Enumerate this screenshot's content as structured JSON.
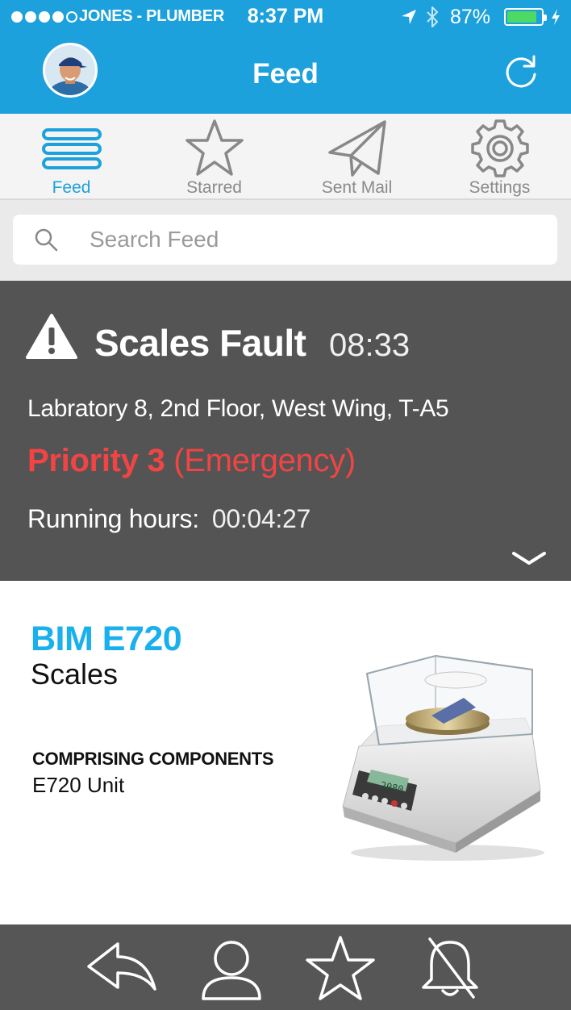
{
  "status_bar": {
    "carrier": "JONES - PLUMBER",
    "time": "8:37 PM",
    "battery_percent": "87%",
    "battery_level": 0.87,
    "signal_bars_filled": 4,
    "signal_bars_total": 5
  },
  "header": {
    "title": "Feed"
  },
  "tabs": [
    {
      "label": "Feed",
      "icon": "list-icon",
      "active": true
    },
    {
      "label": "Starred",
      "icon": "star-icon",
      "active": false
    },
    {
      "label": "Sent Mail",
      "icon": "paper-plane-icon",
      "active": false
    },
    {
      "label": "Settings",
      "icon": "gear-icon",
      "active": false
    }
  ],
  "search": {
    "placeholder": "Search Feed",
    "value": ""
  },
  "alert": {
    "title": "Scales Fault",
    "time": "08:33",
    "location": "Labratory 8, 2nd Floor, West Wing, T-A5",
    "priority_level": "Priority 3",
    "priority_type": "(Emergency)",
    "running_label": "Running hours:",
    "running_value": "00:04:27"
  },
  "asset": {
    "code": "BIM E720",
    "type": "Scales",
    "components_heading": "COMPRISING COMPONENTS",
    "components": [
      "E720 Unit"
    ],
    "display_reading": "2080"
  },
  "toolbar": {
    "buttons": [
      "reply-icon",
      "person-icon",
      "star-icon",
      "bell-off-icon"
    ]
  },
  "colors": {
    "accent": "#1da1dc",
    "asset_code": "#1ab0ec",
    "priority": "#f24444",
    "alert_bg": "#545454",
    "toolbar_bg": "#565656",
    "battery": "#4cd964"
  }
}
